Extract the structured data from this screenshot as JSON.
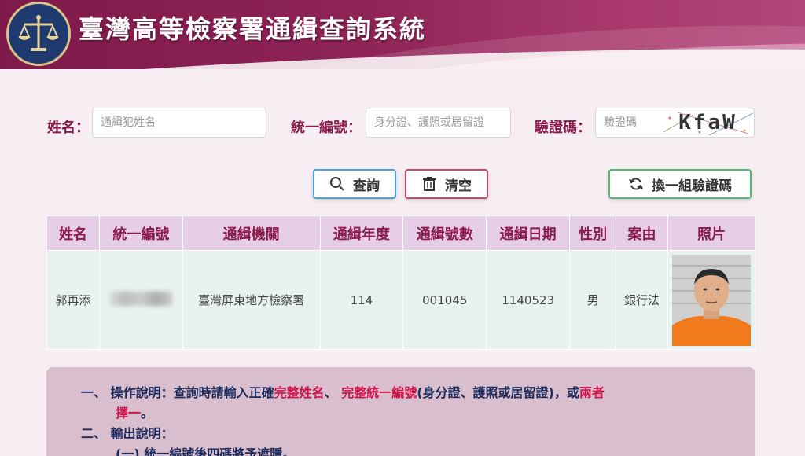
{
  "header": {
    "title": "臺灣高等檢察署通緝查詢系統"
  },
  "form": {
    "name_label": "姓名：",
    "name_placeholder": "通緝犯姓名",
    "id_label": "統一編號：",
    "id_placeholder": "身分證、護照或居留證",
    "captcha_label": "驗證碼：",
    "captcha_placeholder": "驗證碼",
    "captcha_text": "KfaW"
  },
  "buttons": {
    "search": "查詢",
    "clear": "清空",
    "refresh": "換一組驗證碼"
  },
  "table": {
    "headers": [
      "姓名",
      "統一編號",
      "通緝機關",
      "通緝年度",
      "通緝號數",
      "通緝日期",
      "性別",
      "案由",
      "照片"
    ],
    "row": {
      "name": "郭再添",
      "agency": "臺灣屏東地方檢察署",
      "year": "114",
      "number": "001045",
      "date": "1140523",
      "gender": "男",
      "reason": "銀行法"
    }
  },
  "notes": {
    "item1_prefix": "一、",
    "item1_a": "操作說明：查詢時請輸入正確",
    "item1_b": "完整姓名",
    "item1_c": "、 ",
    "item1_d": "完整統一編號",
    "item1_e": "(身分證、護照或居留證)，或",
    "item1_f": "兩者",
    "item1_g": "擇一",
    "item1_h": "。",
    "item2_prefix": "二、",
    "item2_text": "輸出說明：",
    "item2_sub": "(一) 統一編號後四碼將予遮隱。"
  },
  "colors": {
    "header_bg": "#8e2356",
    "label": "#8a1a4c",
    "search_border": "#4aa3d8",
    "clear_border": "#c84a6a",
    "refresh_border": "#56b870",
    "highlight_red": "#d0124a"
  }
}
